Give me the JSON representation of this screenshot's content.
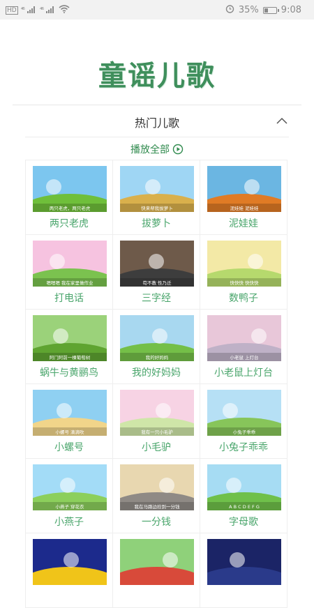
{
  "status_bar": {
    "network": "HD",
    "signal1": "⁴⁶",
    "signal2": "⁴⁶",
    "battery_percent": "35%",
    "battery_level": 0.35,
    "time": "9:08"
  },
  "header": {
    "title": "童谣儿歌"
  },
  "section": {
    "title": "热门儿歌",
    "collapse_icon": "chevron-up-icon",
    "play_all_label": "播放全部",
    "play_icon": "play-circle-icon",
    "accent_color": "#2f8a4d"
  },
  "songs": [
    {
      "title": "两只老虎",
      "caption": "两只老虎，两只老虎",
      "sky": "#7cc6ef",
      "ground": "#6fbf3a"
    },
    {
      "title": "拔萝卜",
      "caption": "快来帮我拔萝卜",
      "sky": "#9fd6f4",
      "ground": "#d9b04c"
    },
    {
      "title": "泥娃娃",
      "caption": "泥娃娃 泥娃娃",
      "sky": "#6bb6e2",
      "ground": "#e07b25"
    },
    {
      "title": "打电话",
      "caption": "嗯嗯嗯 我在家里做作业",
      "sky": "#f6c3e0",
      "ground": "#7bc24f"
    },
    {
      "title": "三字经",
      "caption": "苟不教 性乃迁",
      "sky": "#6e5a4a",
      "ground": "#3d3d3d"
    },
    {
      "title": "数鸭子",
      "caption": "快快快 快快快",
      "sky": "#f3e9a6",
      "ground": "#b6d96d"
    },
    {
      "title": "蜗牛与黄鹂鸟",
      "caption": "阿门阿前一棵葡萄树",
      "sky": "#9bd27a",
      "ground": "#5fa431"
    },
    {
      "title": "我的好妈妈",
      "caption": "我的好妈妈",
      "sky": "#a8d8f0",
      "ground": "#74bf48"
    },
    {
      "title": "小老鼠上灯台",
      "caption": "小老鼠 上灯台",
      "sky": "#e8c7d9",
      "ground": "#bfb1c7"
    },
    {
      "title": "小螺号",
      "caption": "小螺号 滴滴吹",
      "sky": "#8fd0f2",
      "ground": "#f1d58a"
    },
    {
      "title": "小毛驴",
      "caption": "我有一只小毛驴",
      "sky": "#f7d3e4",
      "ground": "#cfe6a8"
    },
    {
      "title": "小兔子乖乖",
      "caption": "小兔子乖乖",
      "sky": "#b6e0f5",
      "ground": "#87c55a"
    },
    {
      "title": "小燕子",
      "caption": "小燕子 穿花衣",
      "sky": "#a3dcf7",
      "ground": "#8ccf5c"
    },
    {
      "title": "一分钱",
      "caption": "我在马路边捡到一分钱",
      "sky": "#e8d7b0",
      "ground": "#8f8a85"
    },
    {
      "title": "字母歌",
      "caption": "A B C D E F G",
      "sky": "#a6dcf3",
      "ground": "#6fc04a"
    },
    {
      "title": "",
      "caption": "",
      "sky": "#1c2a8c",
      "ground": "#f0c419"
    },
    {
      "title": "",
      "caption": "",
      "sky": "#8fd17a",
      "ground": "#d84a3a"
    },
    {
      "title": "",
      "caption": "",
      "sky": "#1b2466",
      "ground": "#2a3a8a"
    }
  ]
}
